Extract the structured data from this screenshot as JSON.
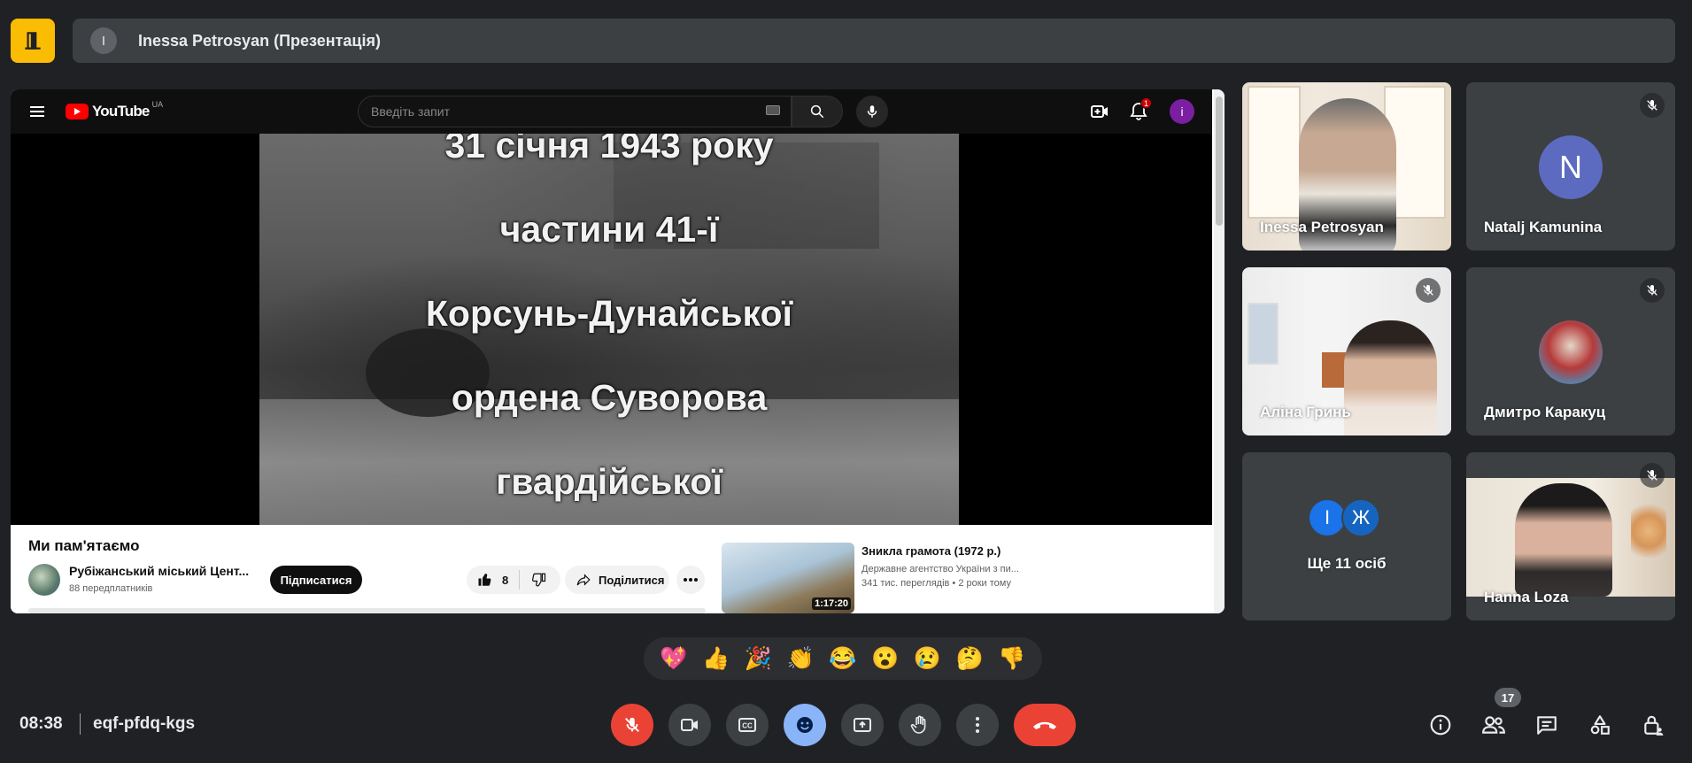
{
  "presenter": {
    "avatar_letter": "I",
    "label": "Inessa Petrosyan (Презентація)"
  },
  "youtube": {
    "logo_text": "YouTube",
    "region": "UA",
    "search_placeholder": "Введіть запит",
    "notification_count": "1",
    "account_letter": "i",
    "video": {
      "subtitle_lines": [
        "31 січня 1943 року",
        "частини 41-ї",
        "Корсунь-Дунайської",
        "ордена Суворова",
        "гвардійської"
      ],
      "title": "Ми пам'ятаємо",
      "channel": "Рубіжанський міський Цент...",
      "subscribers": "88 передплатників",
      "subscribe_label": "Підписатися",
      "likes": "8",
      "share_label": "Поділитися"
    },
    "recommendation": {
      "title": "Зникла грамота (1972 р.)",
      "channel": "Державне агентство України з пи...",
      "meta": "341 тис. переглядів  • 2 роки тому",
      "duration": "1:17:20"
    }
  },
  "participants": [
    {
      "name": "Inessa Petrosyan",
      "type": "video",
      "muted": false
    },
    {
      "name": "Natalj Kamunina",
      "type": "letter",
      "letter": "N",
      "color": "#5c6bc0",
      "muted": true
    },
    {
      "name": "Аліна Гринь",
      "type": "video",
      "muted": true
    },
    {
      "name": "Дмитро Каракуц",
      "type": "photo",
      "muted": true
    },
    {
      "name": "Ще 11 осіб",
      "type": "group",
      "letters": [
        "І",
        "Ж"
      ],
      "colors": [
        "#1a73e8",
        "#1565c0"
      ]
    },
    {
      "name": "Hanna Loza",
      "type": "video",
      "muted": true
    }
  ],
  "reactions": [
    "💖",
    "👍",
    "🎉",
    "👏",
    "😂",
    "😮",
    "😢",
    "🤔",
    "👎"
  ],
  "bottom_bar": {
    "time": "08:38",
    "meeting_code": "eqf-pfdq-kgs",
    "people_count": "17"
  }
}
